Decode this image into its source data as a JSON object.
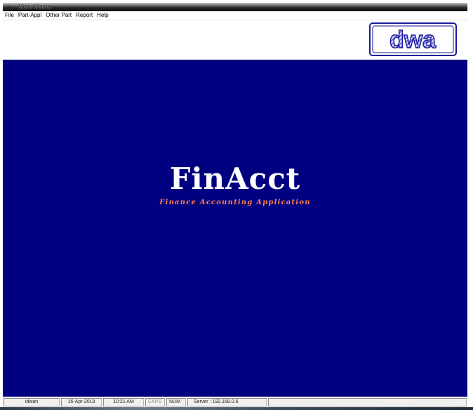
{
  "window": {
    "title": "Menu Utama",
    "icon": "app-glyph-icon"
  },
  "menubar": {
    "items": [
      "File",
      "Part-Appl",
      "Other Part",
      "Report",
      "Help"
    ]
  },
  "header": {
    "logo_text": "dwa",
    "logo_icon": "dwa-logo",
    "colors": {
      "logo_stroke": "#1a1a9a",
      "logo_fill": "#6e6ee0"
    }
  },
  "main": {
    "background": "#000080",
    "app_title": "FinAcct",
    "app_subtitle": "Finance Accounting Application",
    "subtitle_color": "#ff7f50"
  },
  "statusbar": {
    "user": "idwan",
    "date": "16-Apr-2019",
    "time": "10:21 AM",
    "caps": "CAPS",
    "num": "NUM",
    "server": "Server : 192.168.0.6"
  }
}
